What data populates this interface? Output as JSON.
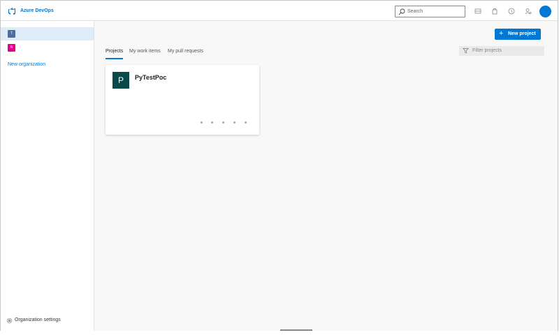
{
  "header": {
    "brand": "Azure DevOps",
    "search_placeholder": "Search",
    "icons": [
      "list-icon",
      "shopping-bag-icon",
      "help-icon",
      "user-settings-icon"
    ],
    "avatar_color": "#0078d4"
  },
  "sidebar": {
    "organizations": [
      {
        "initial": "T",
        "color": "#4a6fa5",
        "active": true
      },
      {
        "initial": "R",
        "color": "#e3008c",
        "active": false
      }
    ],
    "new_org_label": "New organization",
    "settings_label": "Organization settings"
  },
  "main": {
    "new_project_label": "New project",
    "tabs": [
      {
        "label": "Projects",
        "active": true
      },
      {
        "label": "My work items",
        "active": false
      },
      {
        "label": "My pull requests",
        "active": false
      }
    ],
    "filter_placeholder": "Filter projects",
    "projects": [
      {
        "initial": "P",
        "name": "PyTestPoc",
        "color": "#0b4a4a"
      }
    ]
  },
  "colors": {
    "accent": "#0078d4"
  }
}
